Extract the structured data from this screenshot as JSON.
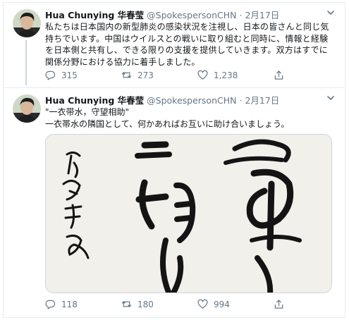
{
  "tweets": [
    {
      "author": "Hua Chunying 华春莹",
      "handle": "@SpokespersonCHN",
      "separator": "·",
      "date": "2月17日",
      "text_lines": [
        "私たちは日本国内の新型肺炎の感染状況を注視し、日本の皆さんと同じ気",
        "持ちでいます。中国はウイルスとの戦いに取り組むと同時に、情報と経験",
        "を日本側と共有し、できる限りの支援を提供していきます。双方はすでに",
        "関係分野における協力に着手しました。"
      ],
      "reply_count": "315",
      "retweet_count": "273",
      "like_count": "1,238"
    },
    {
      "author": "Hua Chunying 华春莹",
      "handle": "@SpokespersonCHN",
      "separator": "·",
      "date": "2月17日",
      "text_lines": [
        "\"一衣带水，守望相助\"",
        "一衣帯水の隣国として、何かあればお互いに助け合いましょう。"
      ],
      "reply_count": "118",
      "retweet_count": "180",
      "like_count": "994"
    }
  ],
  "icons": {
    "reply": "reply-icon",
    "retweet": "retweet-icon",
    "like": "heart-icon",
    "share": "share-icon",
    "menu": "chevron-down-icon"
  },
  "colors": {
    "secondary_text": "#657786",
    "border": "#e6ecf0"
  }
}
